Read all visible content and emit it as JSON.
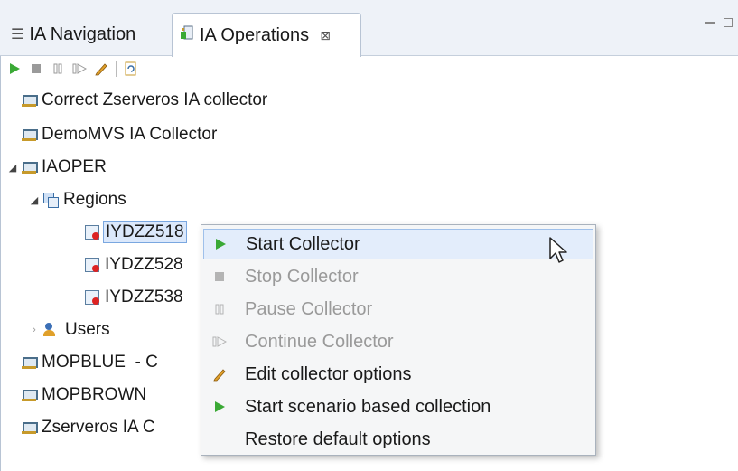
{
  "tabs": [
    {
      "label": "IA Navigation",
      "icon": "navigation-icon",
      "active": false
    },
    {
      "label": "IA Operations",
      "icon": "operations-icon",
      "active": true,
      "close": "⊠"
    }
  ],
  "toolbar": {
    "buttons": [
      "start-icon",
      "stop-icon",
      "pause-icon",
      "continue-icon",
      "edit-icon",
      "restore-icon"
    ]
  },
  "tree": {
    "items": [
      {
        "label": "Correct Zserveros IA collector",
        "icon": "server-icon"
      },
      {
        "label": "DemoMVS IA Collector",
        "icon": "server-icon"
      },
      {
        "label": "IAOPER",
        "icon": "server-icon",
        "expanded": true
      },
      {
        "label": "Regions",
        "icon": "region-icon",
        "expanded": true
      },
      {
        "label": "IYDZZ518",
        "icon": "task-icon",
        "selected": true
      },
      {
        "label": "IYDZZ528",
        "icon": "task-icon"
      },
      {
        "label": "IYDZZ538",
        "icon": "task-icon"
      },
      {
        "label": "Users",
        "icon": "users-icon",
        "expanded": false
      },
      {
        "label": "MOPBLUE  - C",
        "icon": "server-icon"
      },
      {
        "label": "MOPBROWN",
        "icon": "server-icon"
      },
      {
        "label": "Zserveros IA C",
        "icon": "server-icon"
      }
    ]
  },
  "context_menu": {
    "items": [
      {
        "label": "Start Collector",
        "icon": "play-icon",
        "enabled": true,
        "hover": true
      },
      {
        "label": "Stop Collector",
        "icon": "stop-icon",
        "enabled": false
      },
      {
        "label": "Pause Collector",
        "icon": "pause-icon",
        "enabled": false
      },
      {
        "label": "Continue Collector",
        "icon": "continue-icon",
        "enabled": false
      },
      {
        "label": "Edit collector options",
        "icon": "pencil-icon",
        "enabled": true
      },
      {
        "label": "Start scenario based collection",
        "icon": "play-icon",
        "enabled": true
      },
      {
        "label": "Restore default options",
        "icon": "none",
        "enabled": true
      }
    ]
  },
  "colors": {
    "play_green": "#3aa935",
    "disabled_gray": "#9a9a9a",
    "tab_bar": "#eef2f8",
    "selection": "#dbe8fb"
  }
}
